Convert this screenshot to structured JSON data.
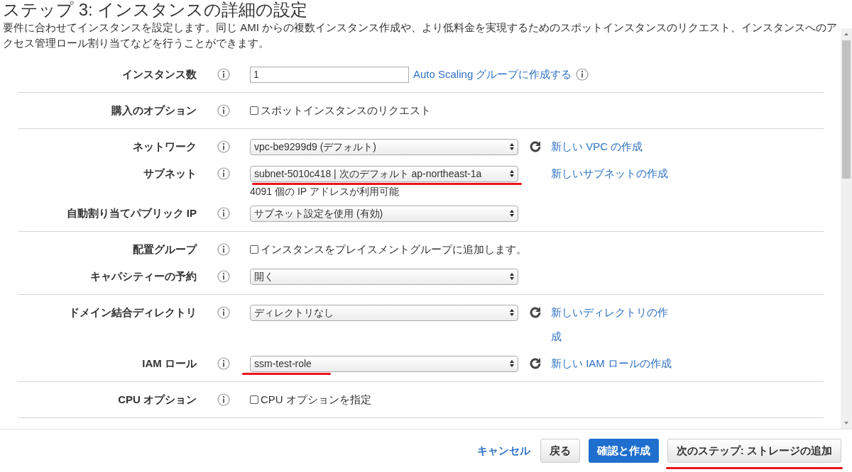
{
  "title": "ステップ 3: インスタンスの詳細の設定",
  "description": "要件に合わせてインスタンスを設定します。同じ AMI からの複数インスタンス作成や、より低料金を実現するためのスポットインスタンスのリクエスト、インスタンスへのアクセス管理ロール割り当てなどを行うことができます。",
  "sections": [
    {
      "rows": [
        {
          "kind": "input",
          "label": "インスタンス数",
          "value": "1",
          "link": "Auto Scaling グループに作成する",
          "link_info": true
        }
      ]
    },
    {
      "rows": [
        {
          "kind": "checkbox",
          "label": "購入のオプション",
          "text": "スポットインスタンスのリクエスト",
          "checked": false
        }
      ]
    },
    {
      "rows": [
        {
          "kind": "select",
          "label": "ネットワーク",
          "value": "vpc-be9299d9 (デフォルト)",
          "refresh": true,
          "link": "新しい VPC の作成"
        },
        {
          "kind": "select",
          "label": "サブネット",
          "value": "subnet-5010c418 | 次のデフォルト ap-northeast-1a",
          "refresh": false,
          "link": "新しいサブネットの作成",
          "help": "4091 個の IP アドレスが利用可能",
          "underlined": true
        },
        {
          "kind": "select",
          "label": "自動割り当てパブリック IP",
          "value": "サブネット設定を使用 (有効)"
        }
      ]
    },
    {
      "rows": [
        {
          "kind": "checkbox",
          "label": "配置グループ",
          "text": "インスタンスをプレイスメントグループに追加します。",
          "checked": false
        },
        {
          "kind": "select",
          "label": "キャパシティーの予約",
          "value": "開く"
        }
      ]
    },
    {
      "rows": [
        {
          "kind": "select",
          "label": "ドメイン結合ディレクトリ",
          "value": "ディレクトリなし",
          "refresh": true,
          "link": "新しいディレクトリの作成"
        },
        {
          "kind": "select",
          "label": "IAM ロール",
          "value": "ssm-test-role",
          "refresh": true,
          "link": "新しい IAM ロールの作成",
          "underlined": true
        }
      ]
    },
    {
      "rows": [
        {
          "kind": "checkbox",
          "label": "CPU オプション",
          "text": "CPU オプションを指定",
          "checked": false
        }
      ]
    }
  ],
  "footer": {
    "cancel": "キャンセル",
    "back": "戻る",
    "review": "確認と作成",
    "next": {
      "label": "次のステップ: ストレージの追加",
      "underlined": true
    }
  }
}
